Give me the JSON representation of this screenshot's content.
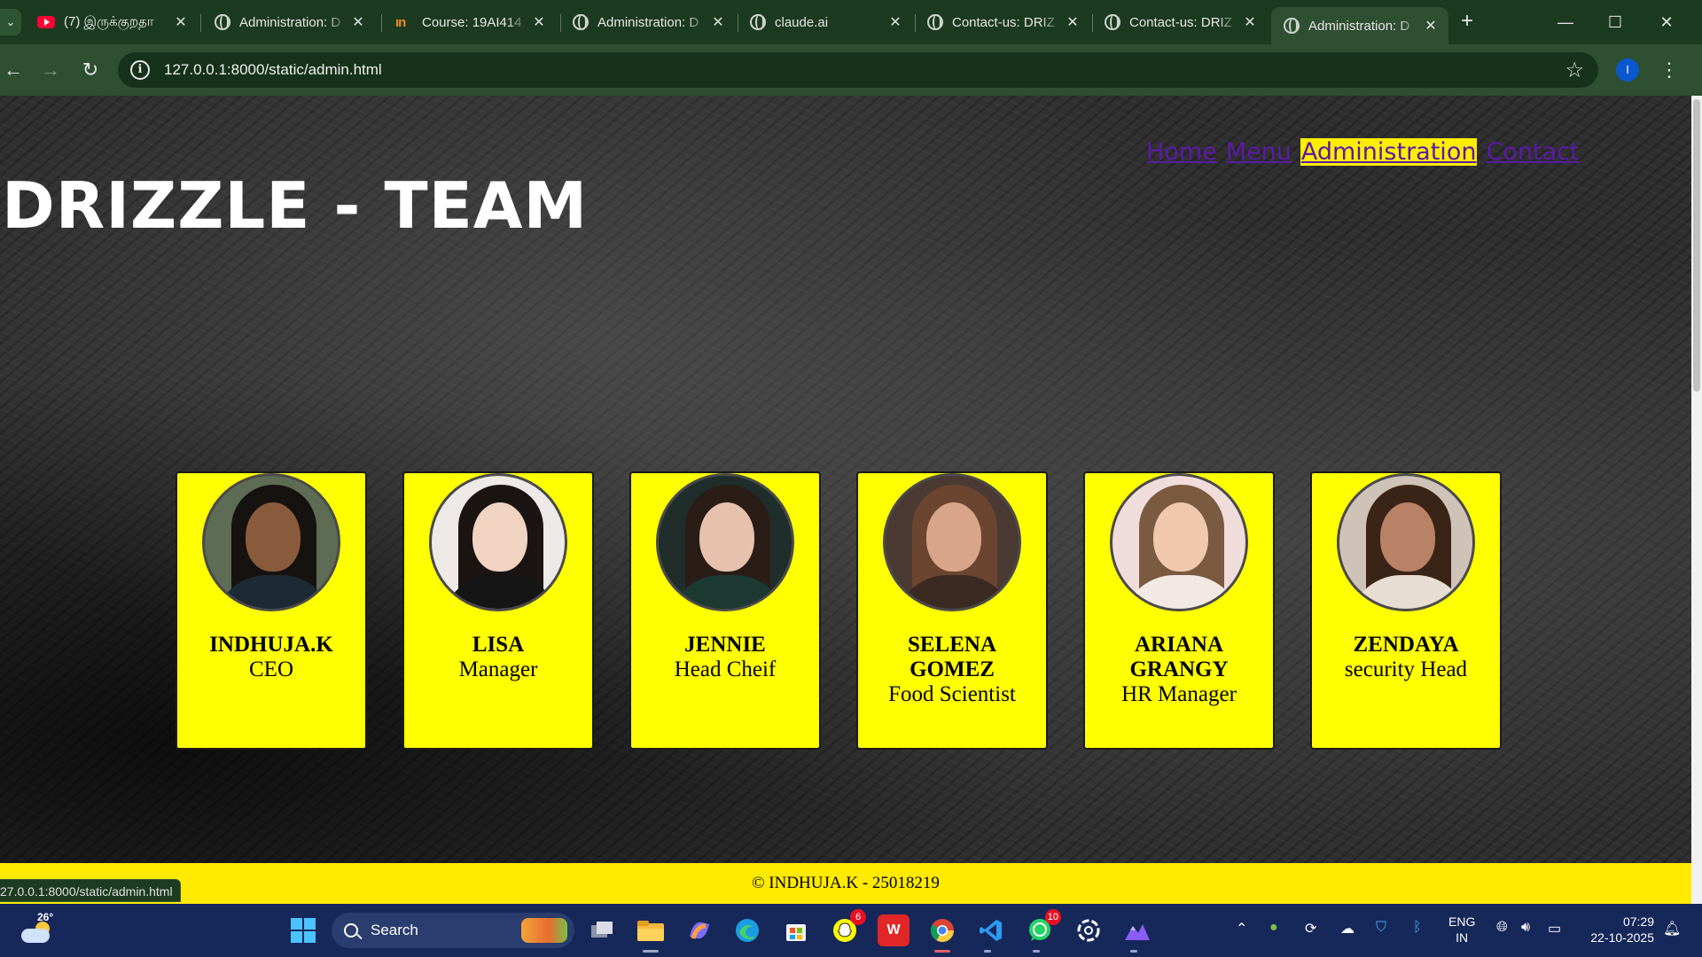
{
  "browser": {
    "tabs": [
      {
        "title": "(7) இருக்குறதா",
        "icon": "youtube-icon"
      },
      {
        "title": "Administration: D",
        "icon": "globe-icon"
      },
      {
        "title": "Course: 19AI414",
        "icon": "nptel-icon"
      },
      {
        "title": "Administration: D",
        "icon": "globe-icon"
      },
      {
        "title": "claude.ai",
        "icon": "globe-icon"
      },
      {
        "title": "Contact-us: DRIZ",
        "icon": "globe-icon"
      },
      {
        "title": "Contact-us: DRIZ",
        "icon": "globe-icon"
      },
      {
        "title": "Administration: D",
        "icon": "globe-icon",
        "active": true
      }
    ],
    "address": "127.0.0.1:8000/static/admin.html",
    "profile_initial": "I",
    "status_url": "27.0.0.1:8000/static/admin.html"
  },
  "page": {
    "title": "DRIZZLE - TEAM",
    "nav": [
      {
        "label": "Home"
      },
      {
        "label": "Menu"
      },
      {
        "label": "Administration",
        "current": true
      },
      {
        "label": "Contact"
      }
    ],
    "team": [
      {
        "name": "INDHUJA.K",
        "role": "CEO"
      },
      {
        "name": "LISA",
        "role": "Manager"
      },
      {
        "name": "JENNIE",
        "role": "Head Cheif"
      },
      {
        "name": "SELENA GOMEZ",
        "role": "Food Scientist"
      },
      {
        "name": "ARIANA GRANGY",
        "role": "HR Manager"
      },
      {
        "name": "ZENDAYA",
        "role": "security Head"
      }
    ],
    "footer": "© INDHUJA.K - 25018219"
  },
  "taskbar": {
    "weather_temp": "26°",
    "search_label": "Search",
    "apps": [
      {
        "name": "task-view",
        "badge": ""
      },
      {
        "name": "file-explorer",
        "badge": ""
      },
      {
        "name": "copilot",
        "badge": ""
      },
      {
        "name": "edge",
        "badge": ""
      },
      {
        "name": "microsoft-store",
        "badge": ""
      },
      {
        "name": "snapchat",
        "badge": "6"
      },
      {
        "name": "wps-office",
        "badge": ""
      },
      {
        "name": "chrome",
        "badge": ""
      },
      {
        "name": "vscode",
        "badge": ""
      },
      {
        "name": "whatsapp",
        "badge": "10"
      },
      {
        "name": "chatgpt",
        "badge": ""
      },
      {
        "name": "app-mountains",
        "badge": ""
      }
    ],
    "lang_line1": "ENG",
    "lang_line2": "IN",
    "time": "07:29",
    "date": "22-10-2025"
  },
  "colors": {
    "accent_yellow": "#ffff00",
    "footer_yellow": "#ffea00",
    "nav_link": "#5a1aa8",
    "browser_frame": "#1c3a20"
  }
}
